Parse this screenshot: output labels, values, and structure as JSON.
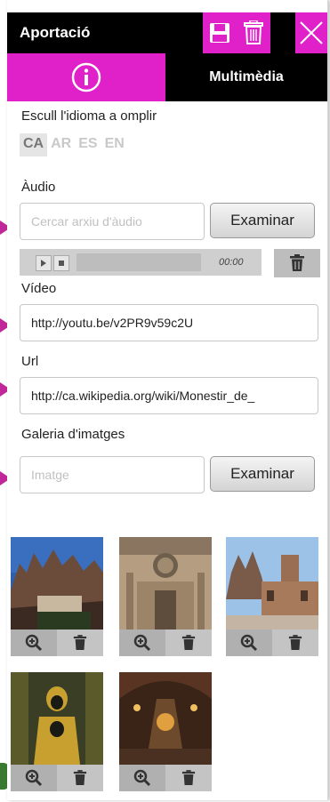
{
  "header": {
    "title": "Aportació"
  },
  "tabs": {
    "media_label": "Multimèdia"
  },
  "language": {
    "label": "Escull l'idioma a omplir",
    "options": [
      "CA",
      "AR",
      "ES",
      "EN"
    ],
    "selected": "CA"
  },
  "audio": {
    "label": "Àudio",
    "placeholder": "Cercar arxiu d'àudio",
    "browse_label": "Examinar",
    "time": "00:00"
  },
  "video": {
    "label": "Vídeo",
    "value": "http://youtu.be/v2PR9v59c2U"
  },
  "url": {
    "label": "Url",
    "value": "http://ca.wikipedia.org/wiki/Monestir_de_"
  },
  "gallery": {
    "label": "Galeria d'imatges",
    "placeholder": "Imatge",
    "browse_label": "Examinar",
    "images": [
      "montserrat-mountain",
      "basilica-facade",
      "monastery-square",
      "black-madonna",
      "basilica-interior"
    ]
  },
  "colors": {
    "accent": "#e020c8",
    "header_bg": "#000000",
    "arrow": "#c0289a"
  }
}
